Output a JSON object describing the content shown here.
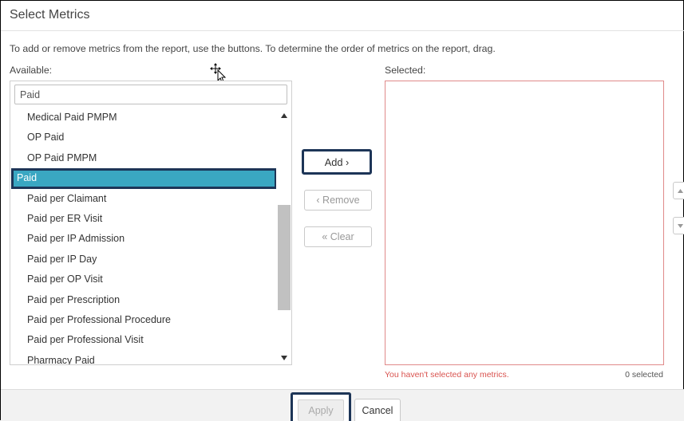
{
  "dialog": {
    "title": "Select Metrics",
    "instructions": "To add or remove metrics from the report, use the buttons. To determine the order of metrics on the report, drag."
  },
  "available": {
    "label": "Available:",
    "filter_value": "Paid",
    "items": [
      "Medical Paid PMPM",
      "OP Paid",
      "OP Paid PMPM",
      "Paid",
      "Paid per Claimant",
      "Paid per ER Visit",
      "Paid per IP Admission",
      "Paid per IP Day",
      "Paid per OP Visit",
      "Paid per Prescription",
      "Paid per Professional Procedure",
      "Paid per Professional Visit",
      "Pharmacy Paid"
    ],
    "highlighted_item": "Paid"
  },
  "buttons": {
    "add": "Add ›",
    "remove": "‹ Remove",
    "clear": "« Clear"
  },
  "selected": {
    "label": "Selected:",
    "error": "You haven't selected any metrics.",
    "count": "0 selected"
  },
  "footer": {
    "apply": "Apply",
    "cancel": "Cancel"
  },
  "colors": {
    "highlight": "#3aa7c2",
    "focus_border": "#1d3557",
    "error": "#d9534f"
  },
  "icons": {
    "cursor": "move-cursor-icon",
    "scroll_up": "triangle-up-icon",
    "scroll_down": "triangle-down-icon"
  }
}
